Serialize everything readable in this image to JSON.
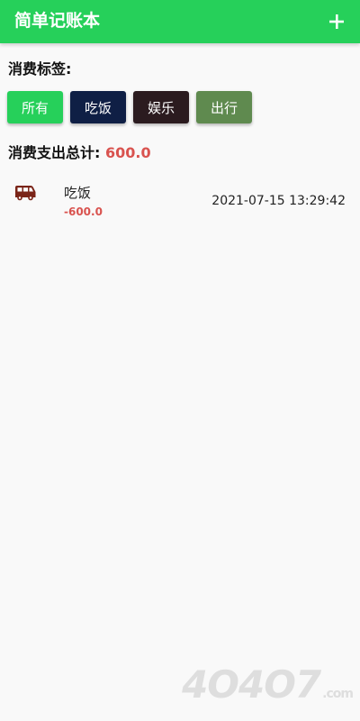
{
  "app_bar": {
    "title": "简单记账本",
    "add_icon": "plus-icon",
    "color": "#26d05a"
  },
  "tags": {
    "label": "消费标签:",
    "items": [
      {
        "label": "所有",
        "color": "#26d05a"
      },
      {
        "label": "吃饭",
        "color": "#0f1f45"
      },
      {
        "label": "娱乐",
        "color": "#2b1b1f"
      },
      {
        "label": "出行",
        "color": "#5f8a4f"
      }
    ]
  },
  "total": {
    "label": "消费支出总计: ",
    "value": "600.0",
    "value_color": "#d9534f"
  },
  "records": [
    {
      "icon": "bus-icon",
      "name": "吃饭",
      "amount": "-600.0",
      "time": "2021-07-15 13:29:42"
    }
  ],
  "watermark": {
    "text": "4O4O7",
    "suffix": ".com"
  }
}
